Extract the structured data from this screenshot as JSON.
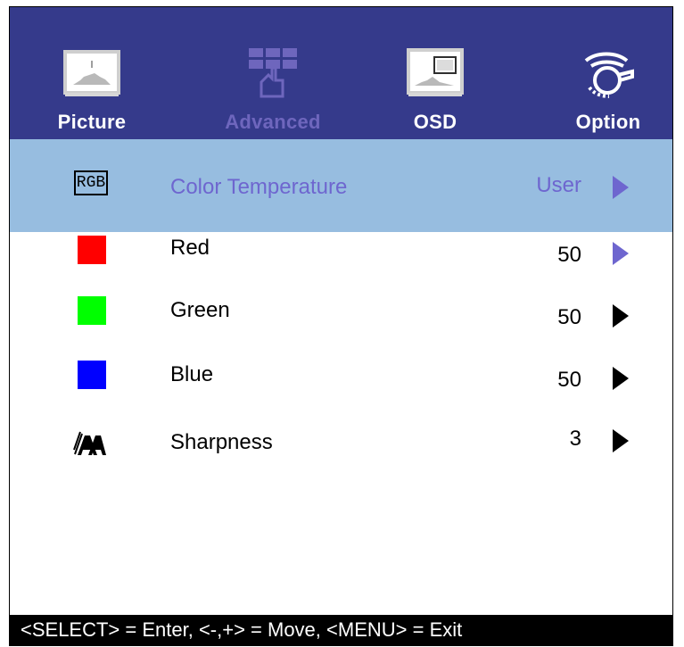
{
  "tabs": [
    {
      "label": "Picture",
      "icon": "picture-icon"
    },
    {
      "label": "Advanced",
      "icon": "advanced-icon"
    },
    {
      "label": "OSD",
      "icon": "osd-icon"
    },
    {
      "label": "Option",
      "icon": "option-icon"
    }
  ],
  "selected_row": {
    "icon": "rgb-icon",
    "icon_text": "RGB",
    "label": "Color Temperature",
    "value": "User"
  },
  "rows": [
    {
      "label": "Red",
      "value": "50",
      "icon": "red-square-icon",
      "color": "#ff0000",
      "arrow_color": "#6e66cf"
    },
    {
      "label": "Green",
      "value": "50",
      "icon": "green-square-icon",
      "color": "#00ff00",
      "arrow_color": "#000000"
    },
    {
      "label": "Blue",
      "value": "50",
      "icon": "blue-square-icon",
      "color": "#0000ff",
      "arrow_color": "#000000"
    },
    {
      "label": "Sharpness",
      "value": "3",
      "icon": "sharpness-icon",
      "arrow_color": "#000000"
    }
  ],
  "footer": "<SELECT> = Enter, <-,+> = Move, <MENU> = Exit",
  "colors": {
    "tabbar_bg": "#353a8b",
    "selected_bg": "#97bde0",
    "selected_text": "#6e66cf",
    "footer_bg": "#000000"
  }
}
